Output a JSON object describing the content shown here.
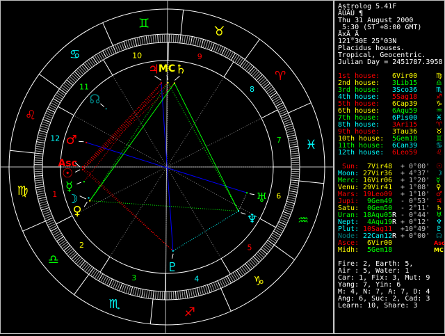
{
  "header": {
    "title": "Astrolog 5.41F",
    "name_garbled": "ÃÚÃÙ ¶",
    "date": "Thu 31 August 2000",
    "time": " 5:30 (ST +8:00 GMT)",
    "place_garbled": "ÃxÃ_Ã",
    "coords": "121°30E 25°03N",
    "house_system": "Placidus houses.",
    "zodiac": "Tropical, Geocentric.",
    "julian": "Julian Day = 2451787.3958"
  },
  "colors": {
    "red": "#ff0000",
    "yellow": "#ffff00",
    "green": "#00ff00",
    "cyan": "#00ffff",
    "teal": "#008080",
    "grey": "#c0c0c0",
    "blue": "#0000ff"
  },
  "houses": [
    {
      "label": "1st house:",
      "value": "6Vir00",
      "sign": "virgo-icon",
      "lon": 156.0
    },
    {
      "label": "2nd house:",
      "value": "3Lib15",
      "sign": "libra-icon",
      "lon": 183.25
    },
    {
      "label": "3rd house:",
      "value": "3Sco36",
      "sign": "scorpio-icon",
      "lon": 213.6
    },
    {
      "label": "4th house:",
      "value": "5Sag18",
      "sign": "sagittarius-icon",
      "lon": 245.3
    },
    {
      "label": "5th house:",
      "value": "6Cap39",
      "sign": "capricorn-icon",
      "lon": 276.65
    },
    {
      "label": "6th house:",
      "value": "6Aqu59",
      "sign": "aquarius-icon",
      "lon": 306.98
    },
    {
      "label": "7th house:",
      "value": "6Pis00",
      "sign": "pisces-icon",
      "lon": 336.0
    },
    {
      "label": "8th house:",
      "value": "3Ari15",
      "sign": "aries-icon",
      "lon": 3.25
    },
    {
      "label": "9th house:",
      "value": "3Tau36",
      "sign": "taurus-icon",
      "lon": 33.6
    },
    {
      "label": "10th house:",
      "value": "5Gem18",
      "sign": "gemini-icon",
      "lon": 65.3
    },
    {
      "label": "11th house:",
      "value": "6Can39",
      "sign": "cancer-icon",
      "lon": 96.65
    },
    {
      "label": "12th house:",
      "value": "6Leo59",
      "sign": "leo-icon",
      "lon": 126.98
    }
  ],
  "planets": [
    {
      "key": "sun",
      "label": "Sun:",
      "value": "7Vir48",
      "retro": "",
      "aspect": "+ 0°00'",
      "icon": "sun-icon",
      "color": "red",
      "lon": 157.8
    },
    {
      "key": "moon",
      "label": "Moon:",
      "value": "27Vir36",
      "retro": "",
      "aspect": "+ 4°37'",
      "icon": "moon-icon",
      "color": "cyan",
      "lon": 177.6
    },
    {
      "key": "merc",
      "label": "Merc:",
      "value": "16Vir06",
      "retro": "",
      "aspect": "+ 1°20'",
      "icon": "mercury-icon",
      "color": "green",
      "lon": 166.1
    },
    {
      "key": "venu",
      "label": "Venu:",
      "value": "29Vir41",
      "retro": "",
      "aspect": "+ 1°08'",
      "icon": "venus-icon",
      "color": "yellow",
      "lon": 179.68
    },
    {
      "key": "mars",
      "label": "Mars:",
      "value": "19Leo09",
      "retro": "",
      "aspect": "+ 1°10'",
      "icon": "mars-icon",
      "color": "red",
      "lon": 139.15
    },
    {
      "key": "jupi",
      "label": "Jupi:",
      "value": "9Gem49",
      "retro": "",
      "aspect": "- 0°53'",
      "icon": "jupiter-icon",
      "color": "red",
      "lon": 69.82
    },
    {
      "key": "satu",
      "label": "Satu:",
      "value": "0Gem50",
      "retro": "",
      "aspect": "- 2°11'",
      "icon": "saturn-icon",
      "color": "yellow",
      "lon": 60.83
    },
    {
      "key": "uran",
      "label": "Uran:",
      "value": "18Aqu05",
      "retro": "R",
      "aspect": "- 0°44'",
      "icon": "uranus-icon",
      "color": "green",
      "lon": 318.08
    },
    {
      "key": "nept",
      "label": "Nept:",
      "value": "4Aqu19",
      "retro": "R",
      "aspect": "+ 0°12'",
      "icon": "neptune-icon",
      "color": "cyan",
      "lon": 304.32
    },
    {
      "key": "plut",
      "label": "Plut:",
      "value": "10Sag11",
      "retro": "",
      "aspect": "+10°49'",
      "icon": "pluto-icon",
      "color": "cyan",
      "lon": 250.18
    },
    {
      "key": "node",
      "label": "Node:",
      "value": "22Can12",
      "retro": "R",
      "aspect": "+ 0°00'",
      "icon": "node-icon",
      "color": "teal",
      "lon": 112.2
    },
    {
      "key": "asce",
      "label": "Asce:",
      "value": "6Vir00",
      "retro": "",
      "aspect": "",
      "icon": "ascendant-icon",
      "color": "red",
      "lon": 156.0
    },
    {
      "key": "midh",
      "label": "Midh:",
      "value": "5Gem18",
      "retro": "",
      "aspect": "",
      "icon": "midheaven-icon",
      "color": "yellow",
      "lon": 65.3
    }
  ],
  "wheel": {
    "asc_label": "Asc",
    "mc_label": "MC",
    "signs": [
      "aries-icon",
      "taurus-icon",
      "gemini-icon",
      "cancer-icon",
      "leo-icon",
      "virgo-icon",
      "libra-icon",
      "scorpio-icon",
      "sagittarius-icon",
      "capricorn-icon",
      "aquarius-icon",
      "pisces-icon"
    ],
    "house_numbers": [
      "1",
      "2",
      "3",
      "4",
      "5",
      "6",
      "7",
      "8",
      "9",
      "10",
      "11",
      "12"
    ],
    "aspects": [
      {
        "a": "mars",
        "b": "uran",
        "type": "opposition"
      },
      {
        "a": "jupi",
        "b": "plut",
        "type": "opposition"
      },
      {
        "a": "satu",
        "b": "venu",
        "type": "trine"
      },
      {
        "a": "satu",
        "b": "nept",
        "type": "trine"
      },
      {
        "a": "midh",
        "b": "venu",
        "type": "trine-wide"
      },
      {
        "a": "midh",
        "b": "nept",
        "type": "trine-wide"
      },
      {
        "a": "venu",
        "b": "nept",
        "type": "trine-wide"
      },
      {
        "a": "sun",
        "b": "jupi",
        "type": "square"
      },
      {
        "a": "merc",
        "b": "jupi",
        "type": "square"
      },
      {
        "a": "asce",
        "b": "jupi",
        "type": "square"
      },
      {
        "a": "asce",
        "b": "midh",
        "type": "square"
      },
      {
        "a": "sun",
        "b": "midh",
        "type": "square"
      },
      {
        "a": "sun",
        "b": "satu",
        "type": "square"
      },
      {
        "a": "sun",
        "b": "plut",
        "type": "square"
      },
      {
        "a": "asce",
        "b": "plut",
        "type": "square"
      },
      {
        "a": "nept",
        "b": "plut",
        "type": "sextile"
      },
      {
        "a": "uran",
        "b": "nept",
        "type": "conjunction"
      }
    ]
  },
  "summary": [
    "Fire: 2, Earth: 5,",
    "Air : 5, Water: 1",
    "Car: 1, Fix: 3, Mut: 9",
    "Yang: 7, Yin: 6",
    "M: 4, N: 7, A: 7, D: 4",
    "Ang: 6, Suc: 2, Cad: 3",
    "Learn: 10, Share: 3"
  ]
}
